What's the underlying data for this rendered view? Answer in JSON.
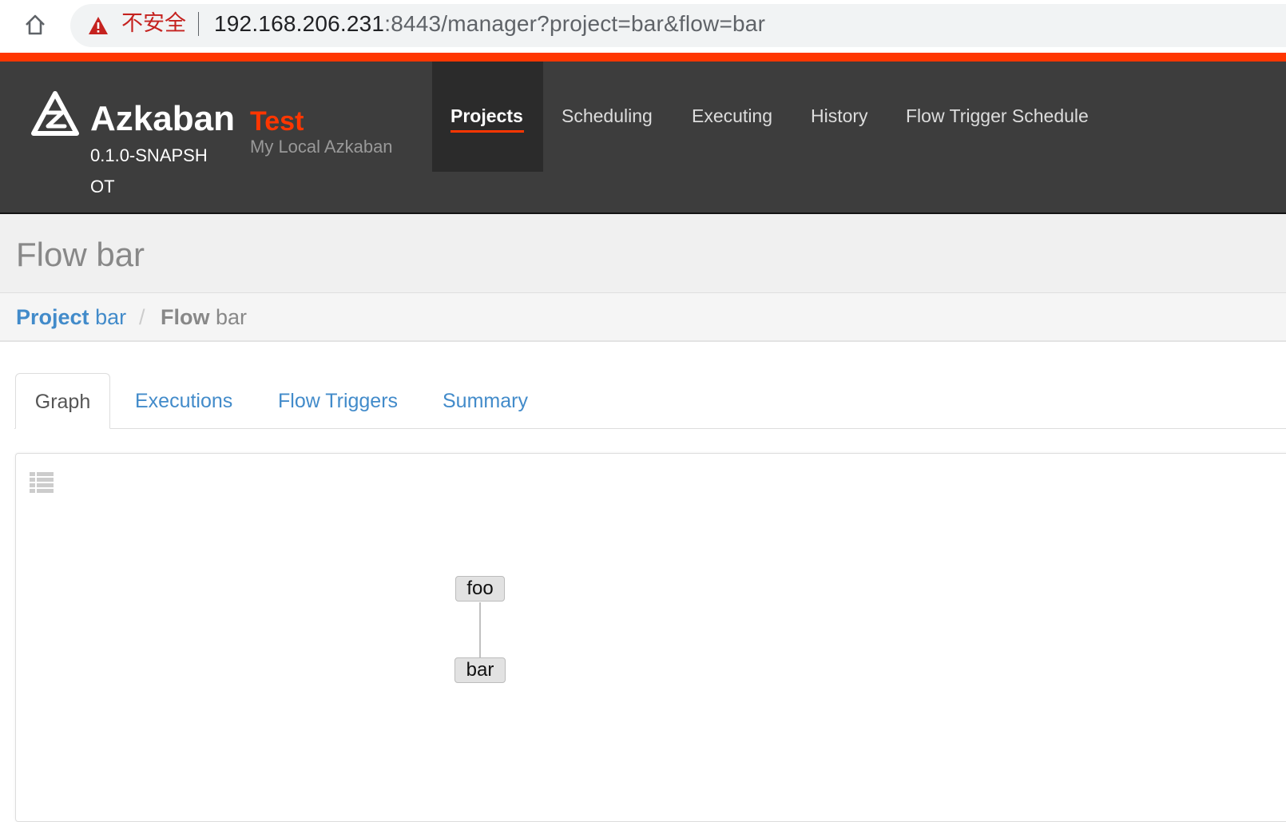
{
  "browser": {
    "security_label": "不安全",
    "url_host": "192.168.206.231",
    "url_rest": ":8443/manager?project=bar&flow=bar"
  },
  "header": {
    "brand": "Azkaban",
    "version": "0.1.0-SNAPSHOT",
    "env_name": "Test",
    "env_description": "My Local Azkaban",
    "nav": [
      "Projects",
      "Scheduling",
      "Executing",
      "History",
      "Flow Trigger Schedule"
    ],
    "active_nav": "Projects",
    "accent_color": "#ff3601",
    "background_color": "#3d3d3d"
  },
  "page": {
    "title": "Flow bar"
  },
  "breadcrumb": {
    "project_label": "Project",
    "project_name": "bar",
    "separator": "/",
    "flow_label": "Flow",
    "flow_name": "bar"
  },
  "tabs": {
    "items": [
      "Graph",
      "Executions",
      "Flow Triggers",
      "Summary"
    ],
    "active": "Graph"
  },
  "graph": {
    "nodes": [
      "foo",
      "bar"
    ],
    "edges": [
      [
        "foo",
        "bar"
      ]
    ]
  },
  "icons": {
    "home": "home-icon",
    "warning": "warning-icon",
    "logo": "azkaban-logo-icon",
    "job_list": "list-icon"
  }
}
